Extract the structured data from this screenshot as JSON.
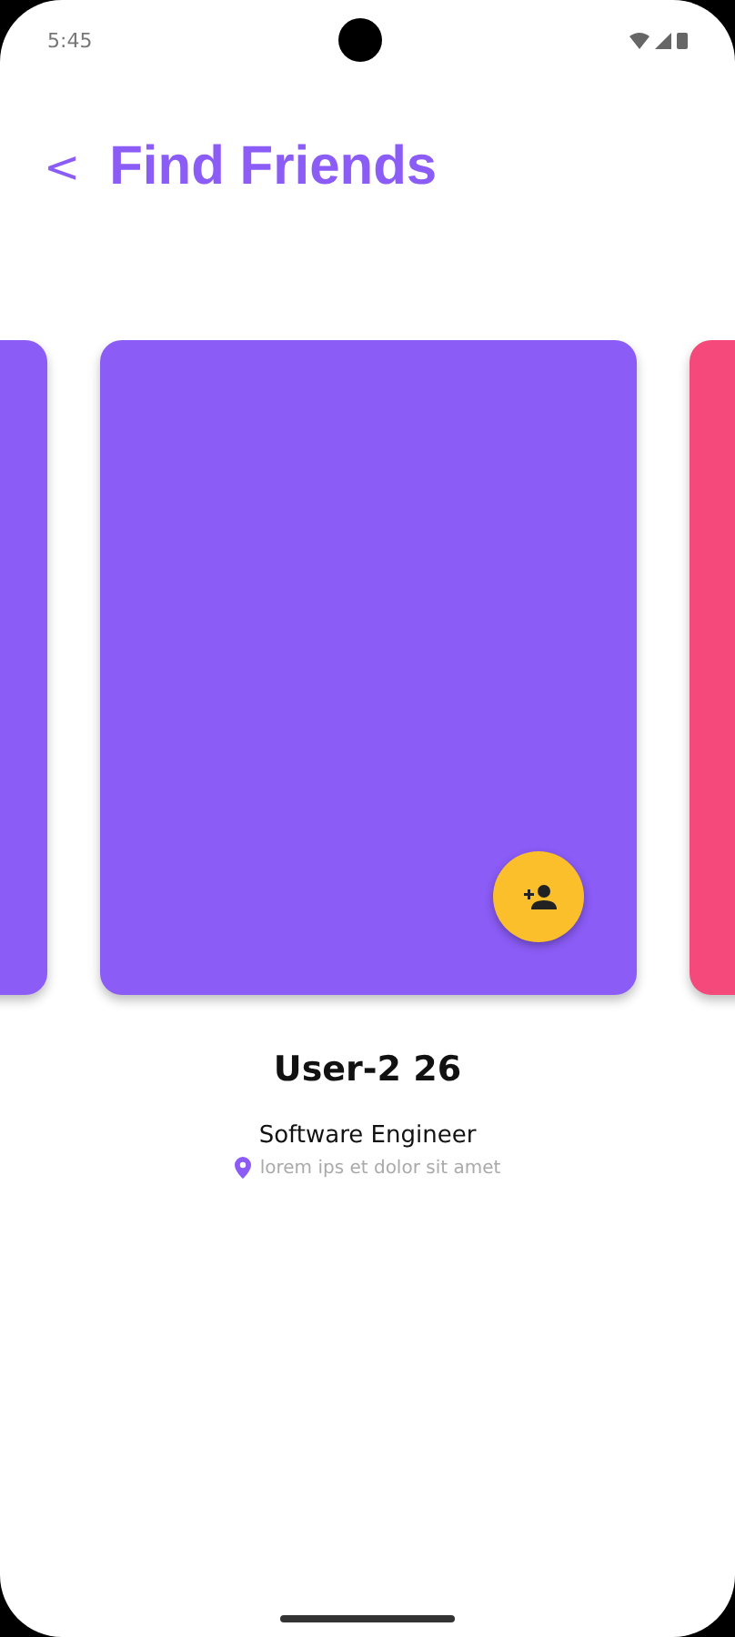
{
  "status_bar": {
    "time": "5:45"
  },
  "header": {
    "back_icon": "<",
    "title": "Find Friends"
  },
  "cards": [
    {
      "color": "#8b5cf6"
    },
    {
      "color": "#8b5cf6",
      "name": "User-2 26",
      "job": "Software Engineer",
      "location": "lorem ips et dolor sit amet"
    },
    {
      "color": "#f4497a"
    }
  ]
}
